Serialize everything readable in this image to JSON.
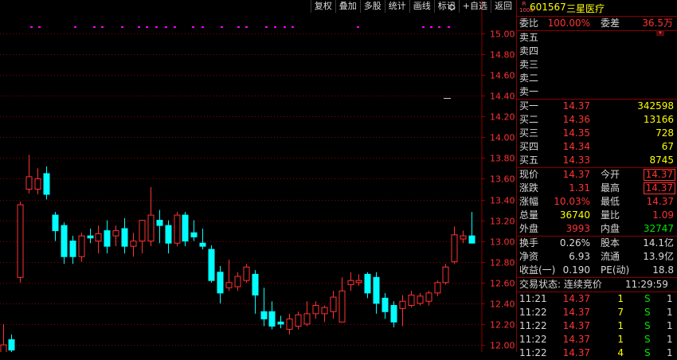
{
  "toolbar": {
    "items": [
      "复权",
      "叠加",
      "多股",
      "统计",
      "画线",
      "标记",
      "+自选",
      "返回"
    ]
  },
  "chart": {
    "y_ticks": [
      "15.00",
      "14.80",
      "14.60",
      "14.40",
      "14.20",
      "14.00",
      "13.80",
      "13.60",
      "13.40",
      "13.20",
      "13.00",
      "12.80",
      "12.60",
      "12.40",
      "12.20",
      "12.00"
    ],
    "up_color": "#ff3232",
    "down_color": "#00ffff",
    "grid_color": "#8b0000"
  },
  "chart_data": {
    "type": "candlestick",
    "y_range": [
      12.0,
      15.0
    ],
    "candles": [
      {
        "o": 11.8,
        "h": 12.2,
        "l": 11.8,
        "c": 12.0
      },
      {
        "o": 12.05,
        "h": 12.1,
        "l": 11.9,
        "c": 11.95
      },
      {
        "o": 12.65,
        "h": 13.38,
        "l": 12.6,
        "c": 13.35
      },
      {
        "o": 13.5,
        "h": 13.83,
        "l": 13.46,
        "c": 13.62
      },
      {
        "o": 13.5,
        "h": 13.7,
        "l": 13.45,
        "c": 13.6
      },
      {
        "o": 13.65,
        "h": 13.72,
        "l": 13.4,
        "c": 13.45
      },
      {
        "o": 13.25,
        "h": 13.28,
        "l": 13.0,
        "c": 13.1
      },
      {
        "o": 13.15,
        "h": 13.18,
        "l": 12.78,
        "c": 12.85
      },
      {
        "o": 13.0,
        "h": 13.05,
        "l": 12.78,
        "c": 12.85
      },
      {
        "o": 12.85,
        "h": 13.08,
        "l": 12.8,
        "c": 13.05
      },
      {
        "o": 13.05,
        "h": 13.12,
        "l": 12.98,
        "c": 13.03
      },
      {
        "o": 13.0,
        "h": 13.15,
        "l": 12.88,
        "c": 13.07
      },
      {
        "o": 13.1,
        "h": 13.2,
        "l": 12.88,
        "c": 12.95
      },
      {
        "o": 13.05,
        "h": 13.15,
        "l": 12.95,
        "c": 13.1
      },
      {
        "o": 13.12,
        "h": 13.22,
        "l": 12.88,
        "c": 12.95
      },
      {
        "o": 12.95,
        "h": 13.08,
        "l": 12.85,
        "c": 13.0
      },
      {
        "o": 13.0,
        "h": 13.2,
        "l": 12.88,
        "c": 13.2
      },
      {
        "o": 13.0,
        "h": 13.52,
        "l": 12.95,
        "c": 13.25
      },
      {
        "o": 13.2,
        "h": 13.3,
        "l": 12.98,
        "c": 13.15
      },
      {
        "o": 13.15,
        "h": 13.2,
        "l": 12.88,
        "c": 12.98
      },
      {
        "o": 12.98,
        "h": 13.28,
        "l": 12.95,
        "c": 13.25
      },
      {
        "o": 13.25,
        "h": 13.28,
        "l": 12.95,
        "c": 13.0
      },
      {
        "o": 13.08,
        "h": 13.2,
        "l": 13.0,
        "c": 13.04
      },
      {
        "o": 12.98,
        "h": 13.12,
        "l": 12.92,
        "c": 12.95
      },
      {
        "o": 12.92,
        "h": 12.96,
        "l": 12.6,
        "c": 12.62
      },
      {
        "o": 12.7,
        "h": 12.76,
        "l": 12.4,
        "c": 12.5
      },
      {
        "o": 12.55,
        "h": 12.82,
        "l": 12.52,
        "c": 12.6
      },
      {
        "o": 12.56,
        "h": 12.7,
        "l": 12.52,
        "c": 12.66
      },
      {
        "o": 12.62,
        "h": 12.78,
        "l": 12.6,
        "c": 12.75
      },
      {
        "o": 12.68,
        "h": 12.72,
        "l": 12.3,
        "c": 12.48
      },
      {
        "o": 12.32,
        "h": 12.55,
        "l": 12.18,
        "c": 12.25
      },
      {
        "o": 12.32,
        "h": 12.42,
        "l": 12.15,
        "c": 12.18
      },
      {
        "o": 12.22,
        "h": 12.28,
        "l": 12.16,
        "c": 12.2
      },
      {
        "o": 12.15,
        "h": 12.3,
        "l": 12.1,
        "c": 12.25
      },
      {
        "o": 12.18,
        "h": 12.32,
        "l": 12.15,
        "c": 12.29
      },
      {
        "o": 12.2,
        "h": 12.42,
        "l": 12.18,
        "c": 12.3
      },
      {
        "o": 12.3,
        "h": 12.42,
        "l": 12.25,
        "c": 12.38
      },
      {
        "o": 12.3,
        "h": 12.38,
        "l": 12.22,
        "c": 12.36
      },
      {
        "o": 12.32,
        "h": 12.52,
        "l": 12.25,
        "c": 12.46
      },
      {
        "o": 12.22,
        "h": 12.65,
        "l": 12.22,
        "c": 12.52
      },
      {
        "o": 12.58,
        "h": 12.7,
        "l": 12.52,
        "c": 12.62
      },
      {
        "o": 12.6,
        "h": 12.68,
        "l": 12.57,
        "c": 12.62
      },
      {
        "o": 12.68,
        "h": 12.7,
        "l": 12.45,
        "c": 12.5
      },
      {
        "o": 12.65,
        "h": 12.7,
        "l": 12.3,
        "c": 12.4
      },
      {
        "o": 12.45,
        "h": 12.5,
        "l": 12.25,
        "c": 12.32
      },
      {
        "o": 12.38,
        "h": 12.42,
        "l": 12.17,
        "c": 12.22
      },
      {
        "o": 12.35,
        "h": 12.48,
        "l": 12.18,
        "c": 12.42
      },
      {
        "o": 12.38,
        "h": 12.52,
        "l": 12.36,
        "c": 12.48
      },
      {
        "o": 12.4,
        "h": 12.5,
        "l": 12.38,
        "c": 12.47
      },
      {
        "o": 12.42,
        "h": 12.52,
        "l": 12.38,
        "c": 12.5
      },
      {
        "o": 12.5,
        "h": 12.62,
        "l": 12.47,
        "c": 12.6
      },
      {
        "o": 12.6,
        "h": 12.78,
        "l": 12.58,
        "c": 12.75
      },
      {
        "o": 12.8,
        "h": 13.14,
        "l": 12.78,
        "c": 13.06
      },
      {
        "o": 13.02,
        "h": 13.1,
        "l": 12.98,
        "c": 13.05
      },
      {
        "o": 13.05,
        "h": 13.28,
        "l": 12.98,
        "c": 12.98
      }
    ]
  },
  "panel": {
    "rz_badge": [
      "R",
      "1000"
    ],
    "code": "601567",
    "name": "三星医疗",
    "weibi": {
      "label": "委比",
      "value": "100.00%",
      "label2": "委差",
      "value2": "36.5万"
    },
    "sells": [
      {
        "label": "卖五",
        "price": "",
        "vol": ""
      },
      {
        "label": "卖四",
        "price": "",
        "vol": ""
      },
      {
        "label": "卖三",
        "price": "",
        "vol": ""
      },
      {
        "label": "卖二",
        "price": "",
        "vol": ""
      },
      {
        "label": "卖一",
        "price": "",
        "vol": ""
      }
    ],
    "buys": [
      {
        "label": "买一",
        "price": "14.37",
        "vol": "342598"
      },
      {
        "label": "买二",
        "price": "14.36",
        "vol": "13166"
      },
      {
        "label": "买三",
        "price": "14.35",
        "vol": "728"
      },
      {
        "label": "买四",
        "price": "14.34",
        "vol": "67"
      },
      {
        "label": "买五",
        "price": "14.33",
        "vol": "8745"
      }
    ],
    "quote": {
      "xj_l": "现价",
      "xj_v": "14.37",
      "jk_l": "今开",
      "jk_v": "14.37",
      "zd_l": "涨跌",
      "zd_v": "1.31",
      "zg_l": "最高",
      "zg_v": "14.37",
      "zf_l": "涨幅",
      "zf_v": "10.03%",
      "zd2_l": "最低",
      "zd2_v": "14.37",
      "zl_l": "总量",
      "zl_v": "36740",
      "lb_l": "量比",
      "lb_v": "1.09",
      "wp_l": "外盘",
      "wp_v": "3993",
      "np_l": "内盘",
      "np_v": "32747"
    },
    "fund": {
      "hs_l": "换手",
      "hs_v": "0.26%",
      "gb_l": "股本",
      "gb_v": "14.1亿",
      "jz_l": "净资",
      "jz_v": "6.93",
      "lt_l": "流通",
      "lt_v": "13.9亿",
      "sy_l": "收益(一)",
      "sy_v": "0.190",
      "pe_l": "PE(动)",
      "pe_v": "18.8"
    },
    "status": {
      "label": "交易状态: 连续竞价",
      "time": "11:29:59"
    },
    "ticks": [
      {
        "time": "11:21",
        "price": "14.37",
        "vol": "1",
        "bs": "S",
        "n": "1"
      },
      {
        "time": "11:22",
        "price": "14.37",
        "vol": "7",
        "bs": "S",
        "n": "1"
      },
      {
        "time": "11:22",
        "price": "14.37",
        "vol": "1",
        "bs": "S",
        "n": "1"
      },
      {
        "time": "11:22",
        "price": "14.37",
        "vol": "1",
        "bs": "S",
        "n": "1"
      },
      {
        "time": "11:22",
        "price": "14.37",
        "vol": "4",
        "bs": "S",
        "n": "1"
      }
    ]
  }
}
